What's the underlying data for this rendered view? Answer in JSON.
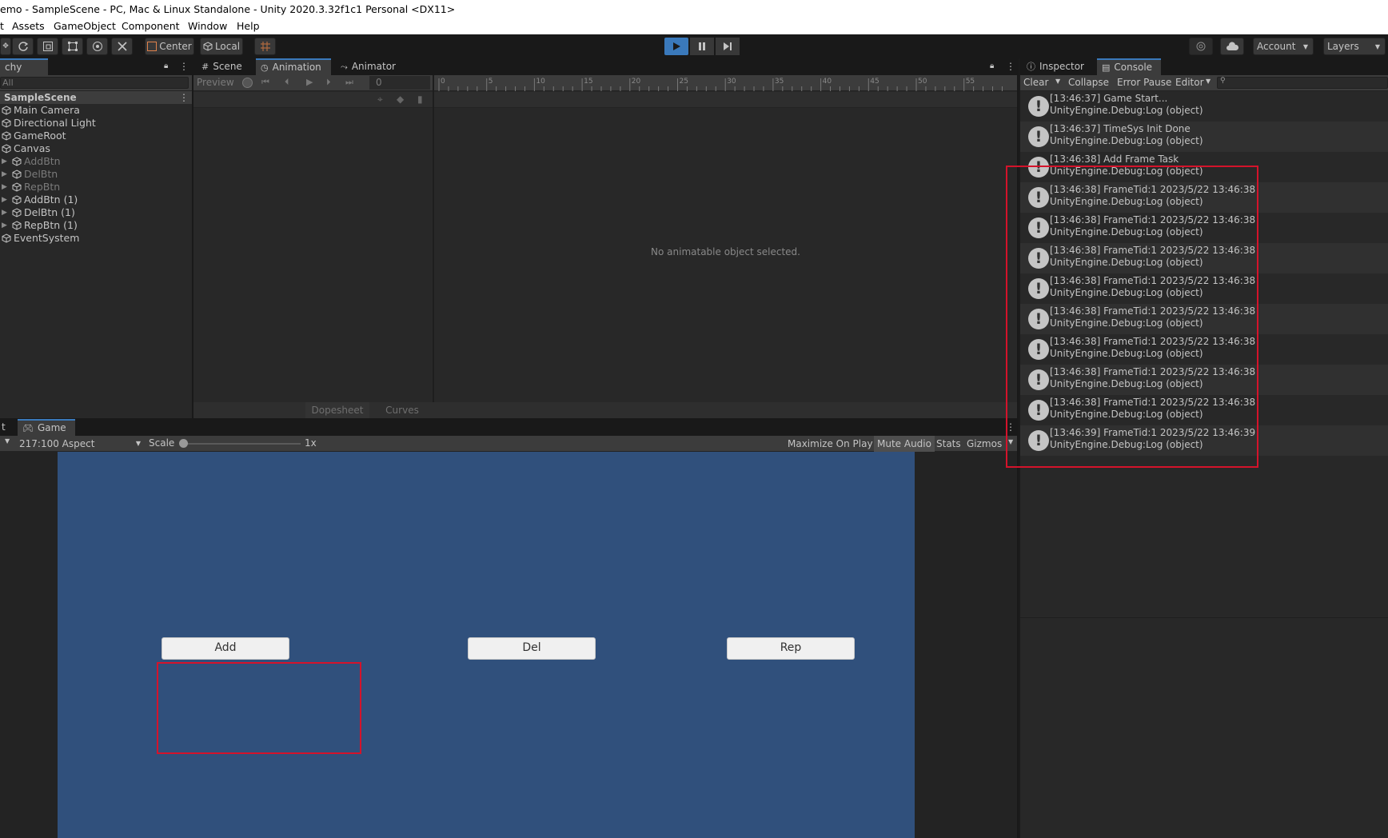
{
  "window": {
    "title": "emo - SampleScene - PC, Mac & Linux Standalone - Unity 2020.3.32f1c1 Personal <DX11>"
  },
  "menu": [
    "t",
    "Assets",
    "GameObject",
    "Component",
    "Window",
    "Help"
  ],
  "toolbar": {
    "center_label": "Center",
    "local_label": "Local",
    "account_label": "Account",
    "layers_label": "Layers"
  },
  "hierarchy": {
    "tab_label": "chy",
    "search_value": "All",
    "scene_name": "SampleScene",
    "items": [
      {
        "label": "Main Camera",
        "dim": false,
        "arrow": false
      },
      {
        "label": "Directional Light",
        "dim": false,
        "arrow": false
      },
      {
        "label": "GameRoot",
        "dim": false,
        "arrow": false
      },
      {
        "label": "Canvas",
        "dim": false,
        "arrow": false
      },
      {
        "label": "AddBtn",
        "dim": true,
        "arrow": true
      },
      {
        "label": "DelBtn",
        "dim": true,
        "arrow": true
      },
      {
        "label": "RepBtn",
        "dim": true,
        "arrow": true
      },
      {
        "label": "AddBtn (1)",
        "dim": false,
        "arrow": true
      },
      {
        "label": "DelBtn (1)",
        "dim": false,
        "arrow": true
      },
      {
        "label": "RepBtn (1)",
        "dim": false,
        "arrow": true
      },
      {
        "label": "EventSystem",
        "dim": false,
        "arrow": false
      }
    ]
  },
  "center_tabs": {
    "scene": "Scene",
    "animation": "Animation",
    "animator": "Animator"
  },
  "animation": {
    "preview_label": "Preview",
    "frame_value": "0",
    "ticks": [
      "0",
      "5",
      "10",
      "15",
      "20",
      "25",
      "30",
      "35",
      "40",
      "45",
      "50",
      "55"
    ],
    "empty_message": "No animatable object selected.",
    "dopesheet_label": "Dopesheet",
    "curves_label": "Curves"
  },
  "game": {
    "left_tab": "t",
    "tab_label": "Game",
    "aspect": "217:100 Aspect",
    "scale_label": "Scale",
    "scale_value": "1x",
    "maximize_label": "Maximize On Play",
    "mute_label": "Mute Audio",
    "stats_label": "Stats",
    "gizmos_label": "Gizmos",
    "bg_color": "#30507c",
    "buttons": {
      "add": "Add",
      "del": "Del",
      "rep": "Rep"
    }
  },
  "right_tabs": {
    "inspector": "Inspector",
    "console": "Console"
  },
  "console": {
    "clear_label": "Clear",
    "collapse_label": "Collapse",
    "error_pause_label": "Error Pause",
    "editor_label": "Editor",
    "logs": [
      {
        "line1": "[13:46:37] Game Start...",
        "line2": "UnityEngine.Debug:Log (object)"
      },
      {
        "line1": "[13:46:37] TimeSys Init Done",
        "line2": "UnityEngine.Debug:Log (object)"
      },
      {
        "line1": "[13:46:38] Add Frame Task",
        "line2": "UnityEngine.Debug:Log (object)"
      },
      {
        "line1": "[13:46:38] FrameTid:1 2023/5/22 13:46:38",
        "line2": "UnityEngine.Debug:Log (object)"
      },
      {
        "line1": "[13:46:38] FrameTid:1 2023/5/22 13:46:38",
        "line2": "UnityEngine.Debug:Log (object)"
      },
      {
        "line1": "[13:46:38] FrameTid:1 2023/5/22 13:46:38",
        "line2": "UnityEngine.Debug:Log (object)"
      },
      {
        "line1": "[13:46:38] FrameTid:1 2023/5/22 13:46:38",
        "line2": "UnityEngine.Debug:Log (object)"
      },
      {
        "line1": "[13:46:38] FrameTid:1 2023/5/22 13:46:38",
        "line2": "UnityEngine.Debug:Log (object)"
      },
      {
        "line1": "[13:46:38] FrameTid:1 2023/5/22 13:46:38",
        "line2": "UnityEngine.Debug:Log (object)"
      },
      {
        "line1": "[13:46:38] FrameTid:1 2023/5/22 13:46:38",
        "line2": "UnityEngine.Debug:Log (object)"
      },
      {
        "line1": "[13:46:38] FrameTid:1 2023/5/22 13:46:38",
        "line2": "UnityEngine.Debug:Log (object)"
      },
      {
        "line1": "[13:46:39] FrameTid:1 2023/5/22 13:46:39",
        "line2": "UnityEngine.Debug:Log (object)"
      }
    ]
  },
  "colors": {
    "highlight_box": "#d4132b",
    "accent": "#3a79bb",
    "panel": "#282828"
  }
}
